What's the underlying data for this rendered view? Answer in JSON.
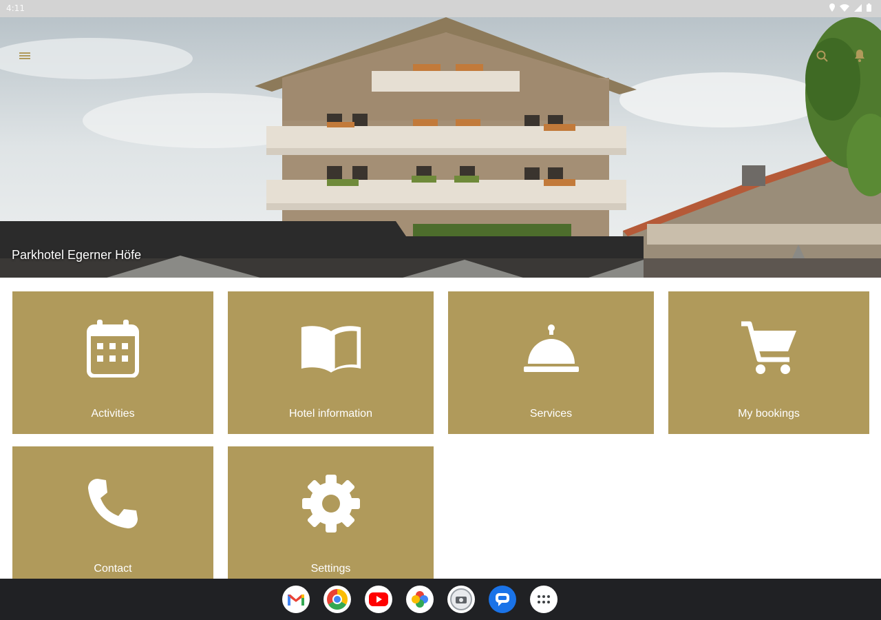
{
  "status_bar": {
    "time": "4:11"
  },
  "hero": {
    "title": "Parkhotel Egerner Höfe"
  },
  "tiles": [
    {
      "label": "Activities",
      "icon": "calendar-icon"
    },
    {
      "label": "Hotel information",
      "icon": "open-book-icon"
    },
    {
      "label": "Services",
      "icon": "service-bell-icon"
    },
    {
      "label": "My bookings",
      "icon": "shopping-cart-icon"
    },
    {
      "label": "Contact",
      "icon": "phone-icon"
    },
    {
      "label": "Settings",
      "icon": "gear-icon"
    }
  ],
  "dock": {
    "apps": [
      "gmail-icon",
      "chrome-icon",
      "youtube-icon",
      "photos-icon",
      "camera-icon",
      "messages-icon",
      "app-drawer-icon"
    ]
  },
  "colors": {
    "tile_accent": "#b09a5b",
    "status_bar": "#d3d3d3",
    "nav_bar": "#202124"
  }
}
